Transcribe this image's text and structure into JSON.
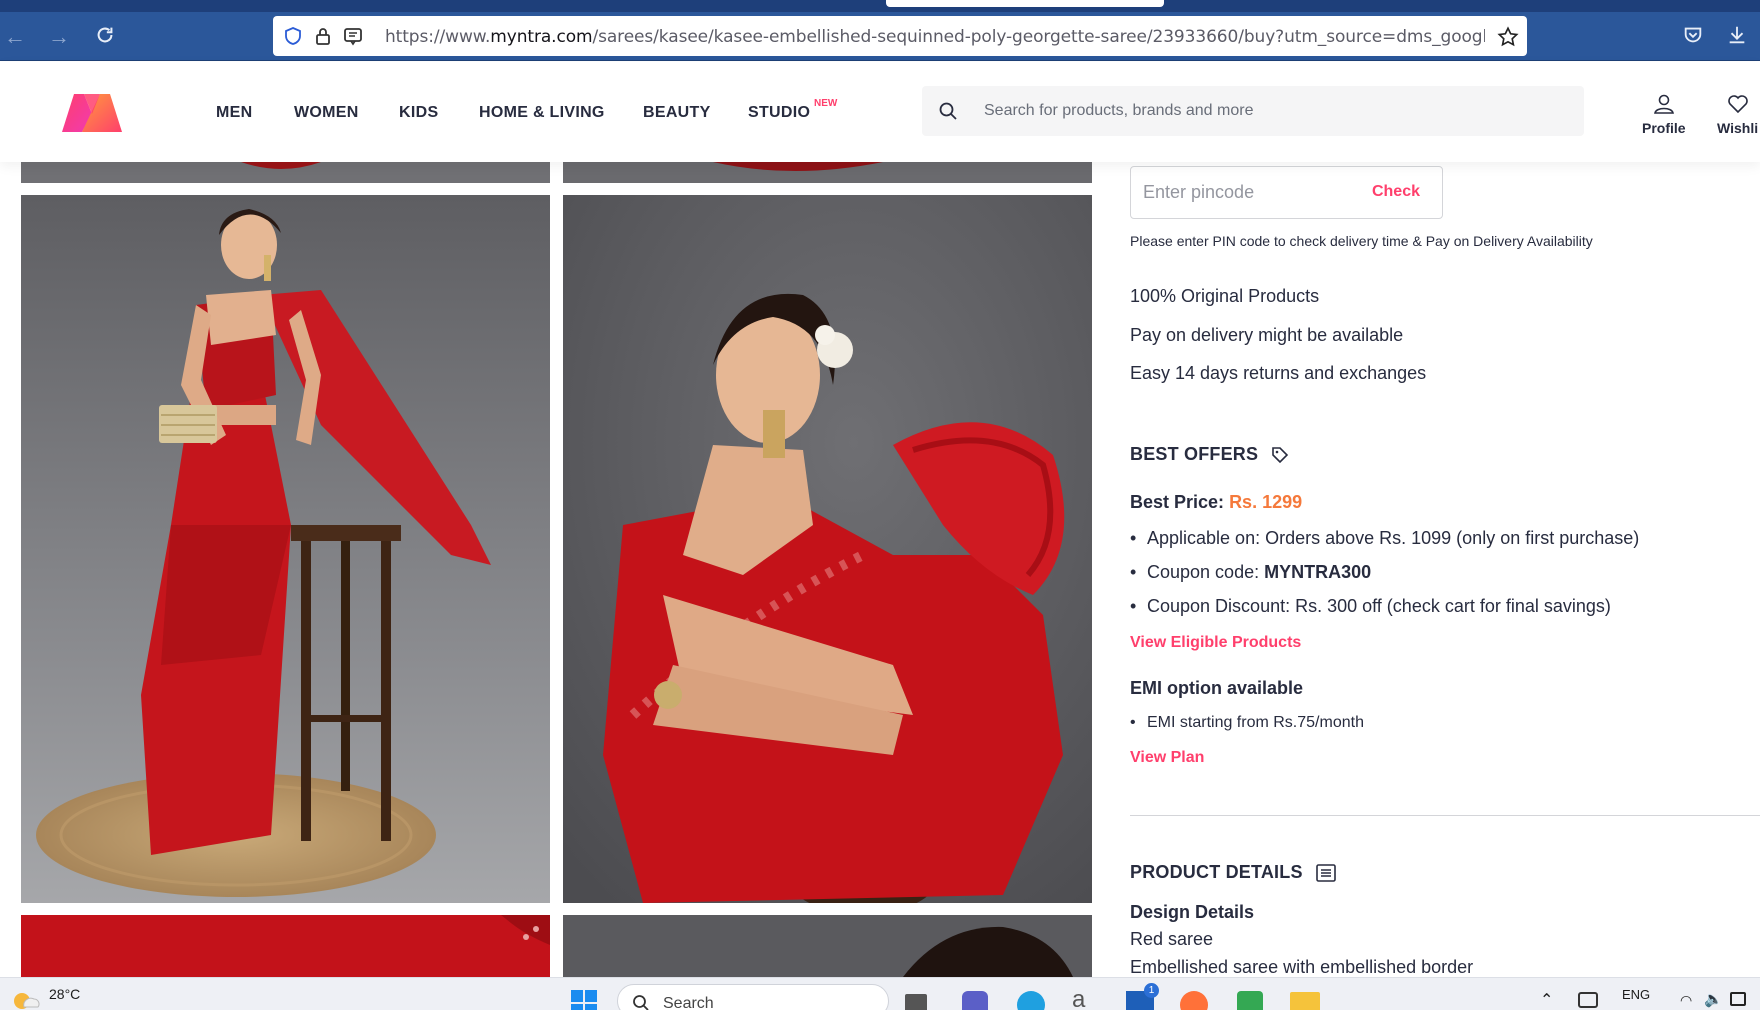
{
  "browser": {
    "url_prefix": "https://www.",
    "url_domain": "myntra.com",
    "url_rest": "/sarees/kasee/kasee-embellished-sequinned-poly-georgette-saree/23933660/buy?utm_source=dms_google&utm_medi",
    "icons": [
      "back-arrow-icon",
      "forward-arrow-icon",
      "reload-icon",
      "shield-icon",
      "lock-icon",
      "reader-view-icon",
      "star-icon",
      "pocket-icon",
      "download-icon"
    ]
  },
  "header": {
    "nav": [
      "MEN",
      "WOMEN",
      "KIDS",
      "HOME & LIVING",
      "BEAUTY",
      "STUDIO"
    ],
    "studio_badge": "NEW",
    "search_placeholder": "Search for products, brands and more",
    "profile_label": "Profile",
    "wishlist_label": "Wishli"
  },
  "delivery": {
    "pincode_placeholder": "Enter pincode",
    "check_label": "Check",
    "note": "Please enter PIN code to check delivery time & Pay on Delivery Availability",
    "assurances": [
      "100% Original Products",
      "Pay on delivery might be available",
      "Easy 14 days returns and exchanges"
    ]
  },
  "offers": {
    "title": "BEST OFFERS",
    "best_price_label": "Best Price:",
    "best_price_value": "Rs. 1299",
    "bullets": {
      "applicable": "Applicable on: Orders above Rs. 1099 (only on first purchase)",
      "coupon_label": "Coupon code: ",
      "coupon_code": "MYNTRA300",
      "discount": "Coupon Discount: Rs. 300 off (check cart for final savings)"
    },
    "eligible_link": "View Eligible Products",
    "emi_title": "EMI option available",
    "emi_bullet": "EMI starting from Rs.75/month",
    "view_plan": "View Plan"
  },
  "product_details": {
    "title": "PRODUCT DETAILS",
    "design_title": "Design Details",
    "lines": [
      "Red saree",
      "Embellished saree with embellished border"
    ]
  },
  "taskbar": {
    "temperature": "28°C",
    "search_label": "Search",
    "language": "ENG",
    "badge_count": "1"
  },
  "colors": {
    "brand_pink": "#ff3f6c",
    "price_orange": "#f5793b",
    "text_dark": "#282c3f",
    "saree_red": "#c5151c",
    "browser_blue": "#2b579a"
  }
}
